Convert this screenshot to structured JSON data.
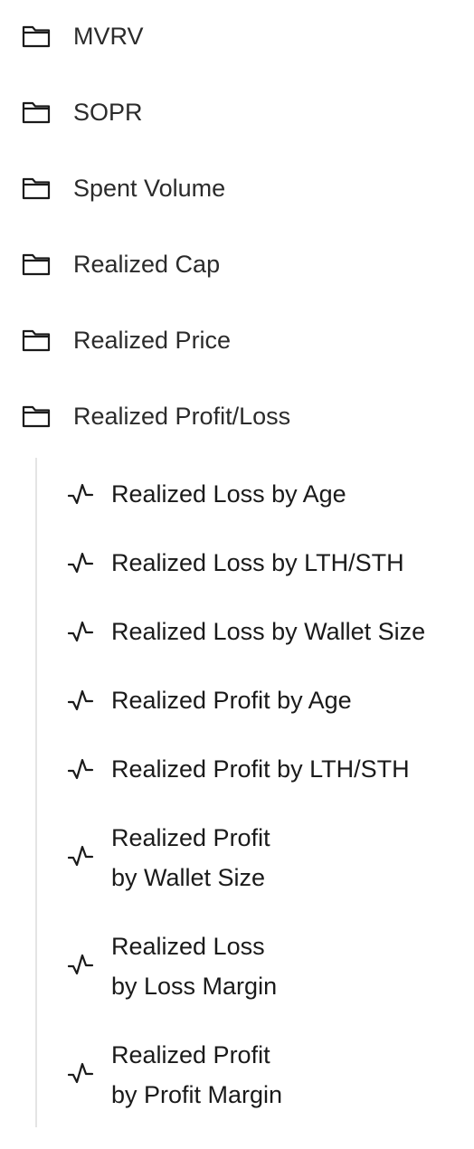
{
  "tree": {
    "folders": [
      {
        "label": "MVRV",
        "icon": "folder-icon"
      },
      {
        "label": "SOPR",
        "icon": "folder-icon"
      },
      {
        "label": "Spent Volume",
        "icon": "folder-icon"
      },
      {
        "label": "Realized Cap",
        "icon": "folder-icon"
      },
      {
        "label": "Realized Price",
        "icon": "folder-icon"
      },
      {
        "label": "Realized Profit/Loss",
        "icon": "folder-icon",
        "expanded": true
      }
    ],
    "children": [
      {
        "label": "Realized Loss by Age",
        "icon": "chart-line-icon"
      },
      {
        "label": "Realized Loss by LTH/STH",
        "icon": "chart-line-icon"
      },
      {
        "label": "Realized Loss by Wallet Size",
        "icon": "chart-line-icon"
      },
      {
        "label": "Realized Profit by Age",
        "icon": "chart-line-icon"
      },
      {
        "label": "Realized Profit by LTH/STH",
        "icon": "chart-line-icon"
      },
      {
        "line1": "Realized Profit",
        "line2": "by Wallet Size",
        "icon": "chart-line-icon"
      },
      {
        "line1": "Realized Loss",
        "line2": "by Loss Margin",
        "icon": "chart-line-icon"
      },
      {
        "line1": "Realized Profit",
        "line2": "by Profit Margin",
        "icon": "chart-line-icon"
      }
    ]
  }
}
